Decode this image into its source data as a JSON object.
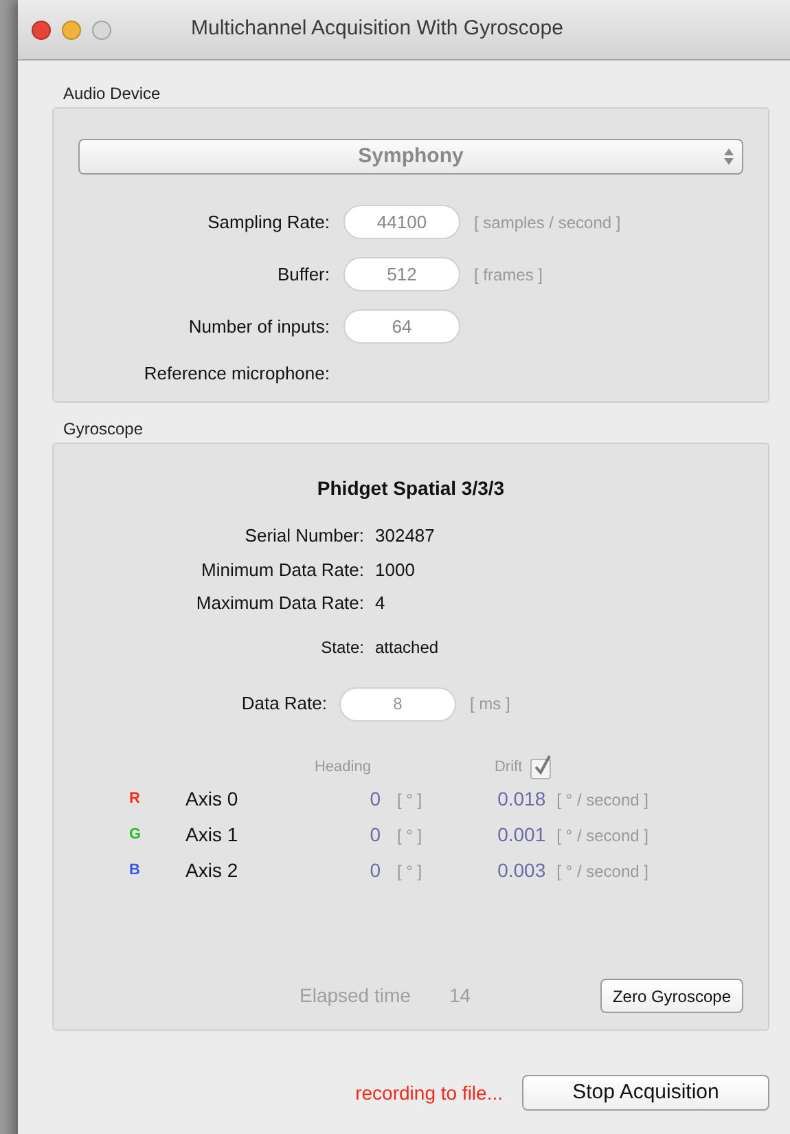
{
  "window": {
    "title": "Multichannel Acquisition With Gyroscope"
  },
  "audio_device": {
    "title": "Audio Device",
    "device": "Symphony",
    "fields": [
      {
        "label": "Sampling Rate:",
        "value": "44100",
        "unit": "[ samples / second ]"
      },
      {
        "label": "Buffer:",
        "value": "512",
        "unit": "[ frames ]"
      },
      {
        "label": "Number of inputs:",
        "value": "64"
      }
    ],
    "reference_label": "Reference microphone:"
  },
  "gyroscope": {
    "title": "Gyroscope",
    "device_name": "Phidget Spatial 3/3/3",
    "info": [
      {
        "label": "Serial Number:",
        "value": "302487"
      },
      {
        "label": "Minimum Data Rate:",
        "value": "1000"
      },
      {
        "label": "Maximum Data Rate:",
        "value": "4"
      }
    ],
    "state": {
      "label": "State:",
      "value": "attached"
    },
    "data_rate": {
      "label": "Data Rate:",
      "value": "8",
      "unit": "[ ms ]"
    },
    "heading_header": "Heading",
    "drift_header": "Drift",
    "drift_checked": true,
    "axes": [
      {
        "letter": "R",
        "color": "#ff2a1a",
        "name": "Axis 0",
        "heading": "0",
        "heading_unit": "[ ° ]",
        "drift": "0.018",
        "drift_unit": "[ ° / second ]"
      },
      {
        "letter": "G",
        "color": "#1fc21f",
        "name": "Axis 1",
        "heading": "0",
        "heading_unit": "[ ° ]",
        "drift": "0.001",
        "drift_unit": "[ ° / second ]"
      },
      {
        "letter": "B",
        "color": "#3a55f0",
        "name": "Axis 2",
        "heading": "0",
        "heading_unit": "[ ° ]",
        "drift": "0.003",
        "drift_unit": "[ ° / second ]"
      }
    ],
    "elapsed_label": "Elapsed time",
    "elapsed_value": "14",
    "zero_button": "Zero Gyroscope"
  },
  "status": "recording to file...",
  "stop_button": "Stop Acquisition"
}
